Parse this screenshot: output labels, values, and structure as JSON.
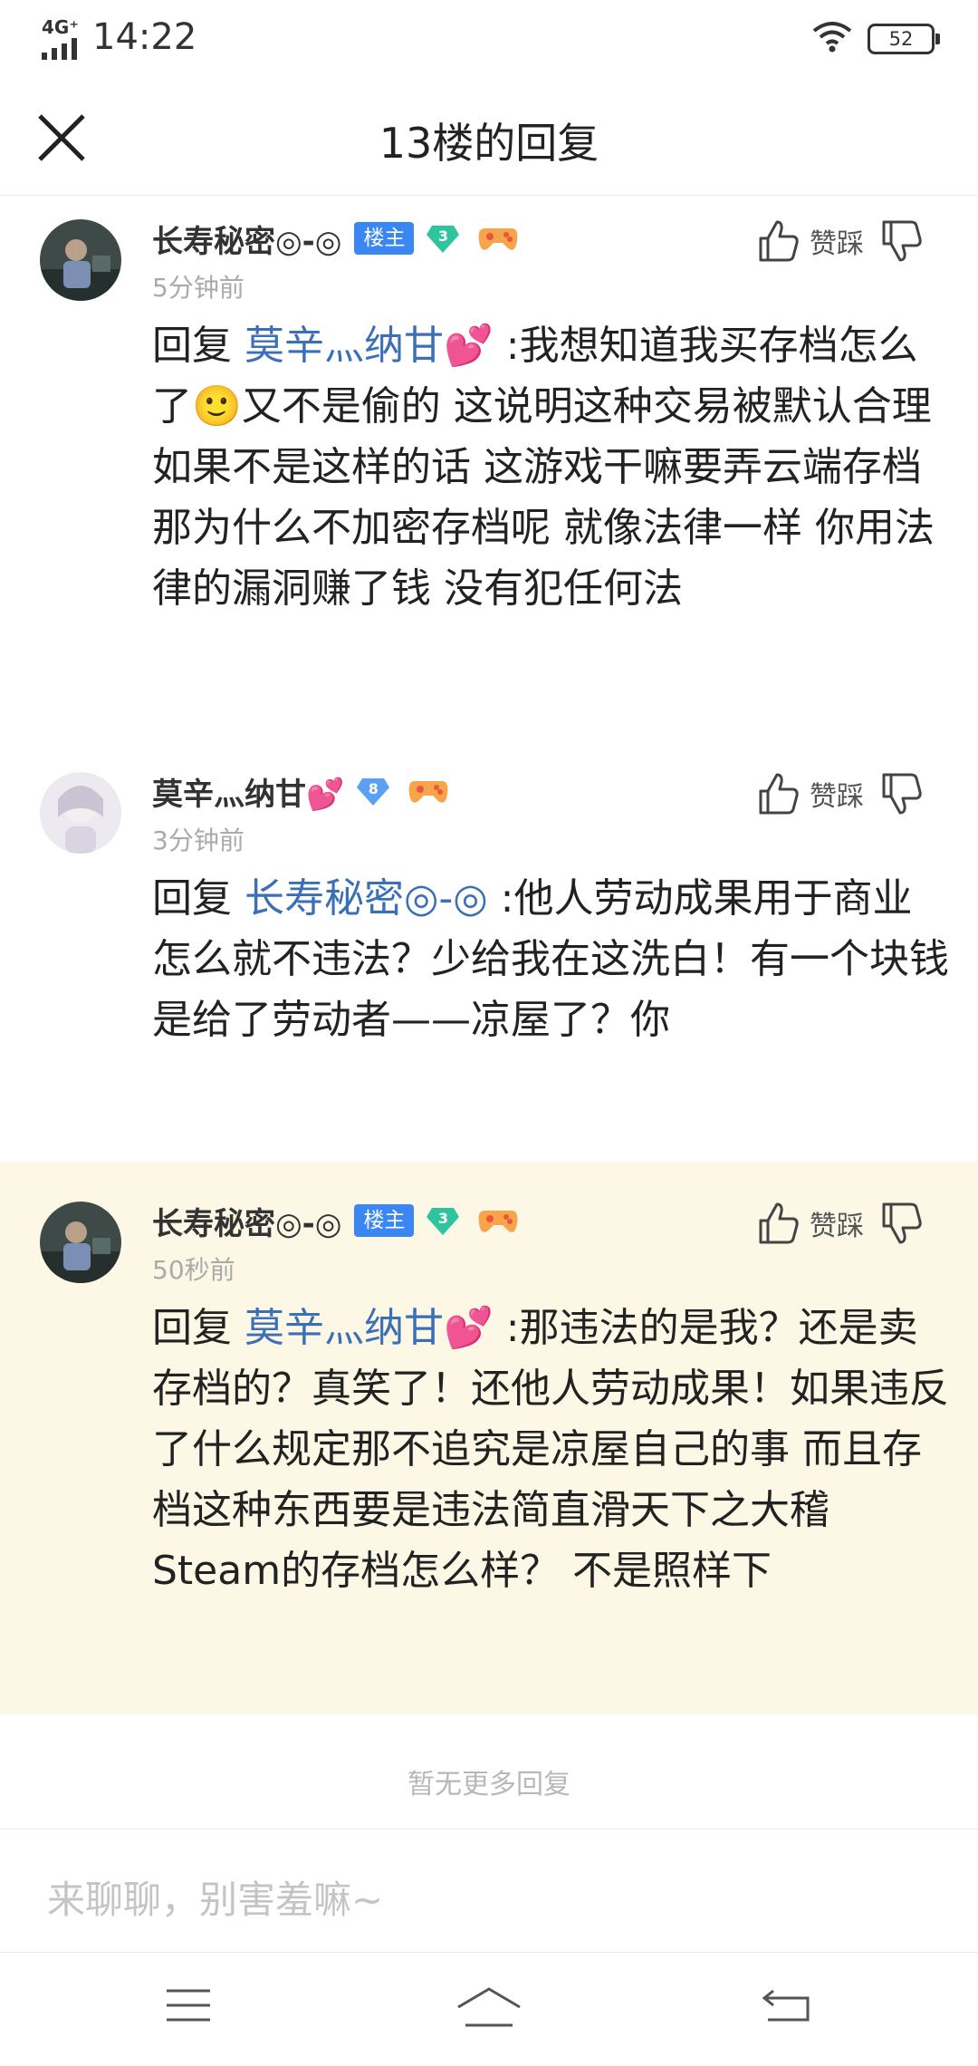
{
  "status": {
    "network": "4G⁺",
    "time": "14:22",
    "battery": "52"
  },
  "header": {
    "title": "13楼的回复",
    "close_icon": "close-icon"
  },
  "labels": {
    "vote": "赞踩",
    "reply_prefix": "回复"
  },
  "replies": [
    {
      "username": "长寿秘密◎-◎",
      "badge": "楼主",
      "level": "3",
      "time": "5分钟前",
      "mention": "莫辛灬纳甘💕",
      "text": ":我想知道我买存档怎么了🙂又不是偷的 这说明这种交易被默认合理 如果不是这样的话 这游戏干嘛要弄云端存档 那为什么不加密存档呢 就像法律一样 你用法律的漏洞赚了钱 没有犯任何法"
    },
    {
      "username": "莫辛灬纳甘💕",
      "level": "8",
      "time": "3分钟前",
      "mention": "长寿秘密◎-◎",
      "text": ":他人劳动成果用于商业怎么就不违法？少给我在这洗白！有一个块钱是给了劳动者——凉屋了？你"
    },
    {
      "username": "长寿秘密◎-◎",
      "badge": "楼主",
      "level": "3",
      "time": "50秒前",
      "mention": "莫辛灬纳甘💕",
      "text": ":那违法的是我？还是卖存档的？真笑了！还他人劳动成果！如果违反了什么规定那不追究是凉屋自己的事 而且存档这种东西要是违法简直滑天下之大稽 Steam的存档怎么样？ 不是照样下"
    }
  ],
  "footer": {
    "no_more": "暂无更多回复",
    "input_placeholder": "来聊聊，别害羞嘛~"
  },
  "colors": {
    "accent": "#3a86f3",
    "mention": "#3b6fb6",
    "highlight_bg": "#fdf8e6",
    "level_green": "#2ec4a0",
    "level_blue": "#5aa0f5"
  }
}
